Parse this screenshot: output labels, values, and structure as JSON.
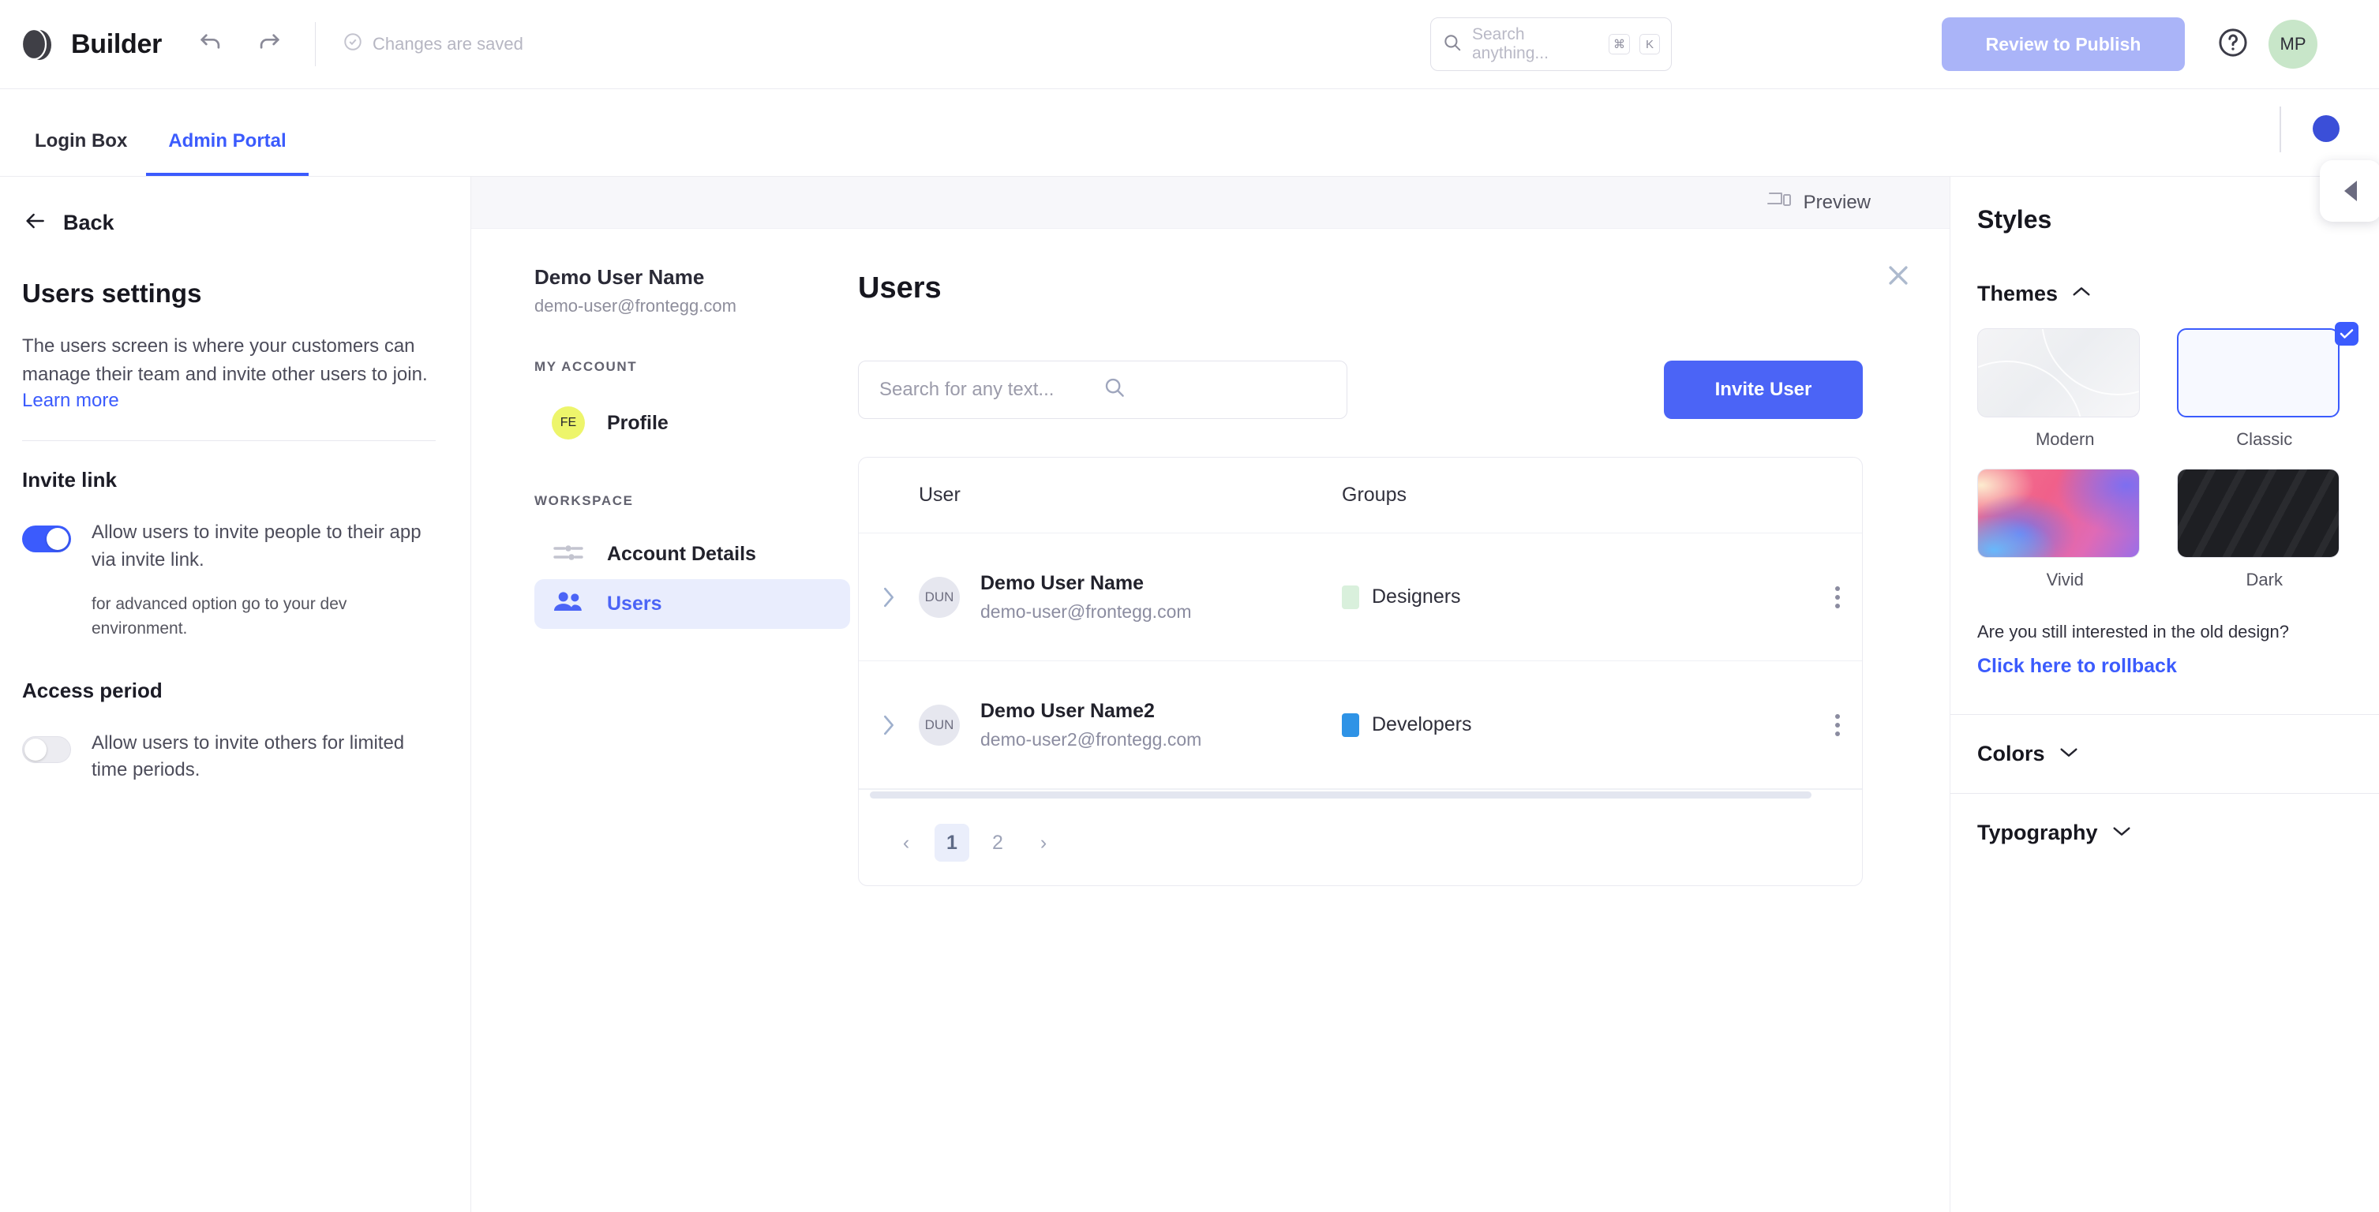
{
  "topbar": {
    "brand": "Builder",
    "undo_icon": "undo-icon",
    "redo_icon": "redo-icon",
    "status_text": "Changes are saved",
    "search_placeholder": "Search anything...",
    "kbd_cmd": "⌘",
    "kbd_key": "K",
    "publish_label": "Review to Publish",
    "help_icon": "question-circle-icon",
    "avatar_initials": "MP",
    "accent_blue": "#3b5bfd",
    "publish_bg": "#aab4f8",
    "avatar_bg": "#c8e6c9"
  },
  "tabs": [
    {
      "label": "Login Box",
      "active": false
    },
    {
      "label": "Admin Portal",
      "active": true
    }
  ],
  "left_panel": {
    "back_label": "Back",
    "heading": "Users settings",
    "description": "The users screen is where your customers can manage their team and invite other users to join.",
    "learn_more": "Learn more",
    "invite_link": {
      "title": "Invite link",
      "toggle_on": true,
      "toggle_label": "Allow users to invite people to their app via invite link.",
      "note": "for advanced option go to your dev environment."
    },
    "access_period": {
      "title": "Access period",
      "toggle_on": false,
      "toggle_label": "Allow users to invite others for limited time periods."
    }
  },
  "preview": {
    "preview_label": "Preview",
    "preview_icon": "devices-icon",
    "close_icon": "close-icon"
  },
  "admin_portal": {
    "user_name": "Demo User Name",
    "user_email": "demo-user@frontegg.com",
    "groups": [
      {
        "label": "MY ACCOUNT",
        "items": [
          {
            "label": "Profile",
            "icon": "avatar-icon",
            "initials": "FE",
            "active": false
          }
        ]
      },
      {
        "label": "WORKSPACE",
        "items": [
          {
            "label": "Account Details",
            "icon": "sliders-icon",
            "active": false
          },
          {
            "label": "Users",
            "icon": "users-icon",
            "active": true
          }
        ]
      }
    ],
    "page_title": "Users",
    "search_placeholder": "Search for any text...",
    "search_icon": "search-icon",
    "invite_button": "Invite User",
    "table": {
      "columns": [
        "User",
        "Groups"
      ],
      "rows": [
        {
          "initials": "DUN",
          "name": "Demo User Name",
          "email": "demo-user@frontegg.com",
          "group": "Designers",
          "group_color": "#d9f0dc"
        },
        {
          "initials": "DUN",
          "name": "Demo User Name2",
          "email": "demo-user2@frontegg.com",
          "group": "Developers",
          "group_color": "#2e93e6"
        }
      ]
    },
    "pagination": {
      "prev": "‹",
      "pages": [
        "1",
        "2"
      ],
      "current": "1",
      "next": "›"
    }
  },
  "styles_panel": {
    "title": "Styles",
    "themes": {
      "title": "Themes",
      "expanded": true,
      "chevron": "chevron-up-icon",
      "items": [
        {
          "name": "Modern",
          "selected": false
        },
        {
          "name": "Classic",
          "selected": true
        },
        {
          "name": "Vivid",
          "selected": false
        },
        {
          "name": "Dark",
          "selected": false
        }
      ],
      "rollback_question": "Are you still interested in the old design?",
      "rollback_link": "Click here to rollback"
    },
    "colors": {
      "title": "Colors",
      "expanded": false,
      "chevron": "chevron-down-icon"
    },
    "typography": {
      "title": "Typography",
      "expanded": false,
      "chevron": "chevron-down-icon"
    }
  }
}
